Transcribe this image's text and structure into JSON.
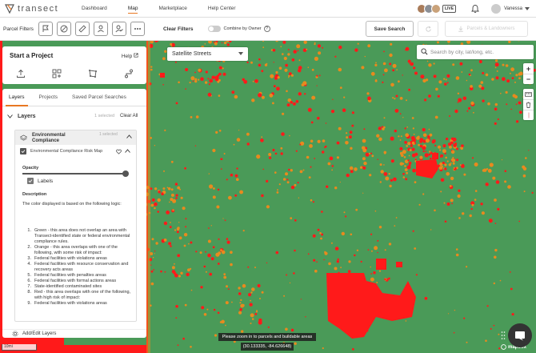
{
  "brand": {
    "name": "transect",
    "accent": "#e87722"
  },
  "nav": {
    "links": [
      "Dashboard",
      "Map",
      "Marketplace",
      "Help Center"
    ],
    "active": "Map"
  },
  "user": {
    "live_badge": "LIVE",
    "name": "Vanessa"
  },
  "filters": {
    "label": "Parcel Filters",
    "clear_label": "Clear Filters",
    "combine_label": "Combine by Owner",
    "help_glyph": "?",
    "save_search": "Save Search",
    "parcels_label": "Parcels & Landowners"
  },
  "project": {
    "title": "Start a Project",
    "help": "Help"
  },
  "panel": {
    "tabs": [
      "Layers",
      "Projects",
      "Saved Parcel Searches"
    ],
    "layers_title": "Layers",
    "selected_count": "1 selected",
    "clear_all": "Clear All",
    "group_name": "Environmental Compliance",
    "group_selected": "1 selected",
    "layer_name": "Environmental Compliance Risk Map",
    "opacity_label": "Opacity",
    "opacity_value": 1.0,
    "labels_label": "Labels",
    "description_label": "Description",
    "description_intro": "The color displayed is based on the following logic:",
    "description_items": [
      {
        "n": "1.",
        "text": "Green - this area does not overlap an area with Transect-identified state or federal environmental compliance rules."
      },
      {
        "n": "2.",
        "text": "Orange - this area overlaps with one of the following, with some risk of impact:"
      },
      {
        "n": "3.",
        "text": "Federal facilities with violations areas"
      },
      {
        "n": "4.",
        "text": "Federal facilities with resource conservation and recovery acts areas"
      },
      {
        "n": "5.",
        "text": "Federal facilities with penalties areas"
      },
      {
        "n": "6.",
        "text": "Federal facilities with formal actions areas"
      },
      {
        "n": "7.",
        "text": "State-identified contaminated sites"
      },
      {
        "n": "8.",
        "text": "Red - this area overlaps with one of the following, with high risk of impact:"
      },
      {
        "n": "9.",
        "text": "Federal facilities with violations areas"
      }
    ],
    "add_edit": "Add/Edit Layers"
  },
  "map": {
    "style_select": "Satellite Streets",
    "search_placeholder": "Search by city, lat/long, etc.",
    "zoom_hint": "Please zoom in to parcels and buildable areas",
    "coordinates": "(30.133335, -84.626648)",
    "scale": "10mi",
    "attribution": "mapbox",
    "colors": {
      "safe": "#4a9a58",
      "some_risk": "#e88a1e",
      "high_risk": "#ff1a1a"
    }
  }
}
